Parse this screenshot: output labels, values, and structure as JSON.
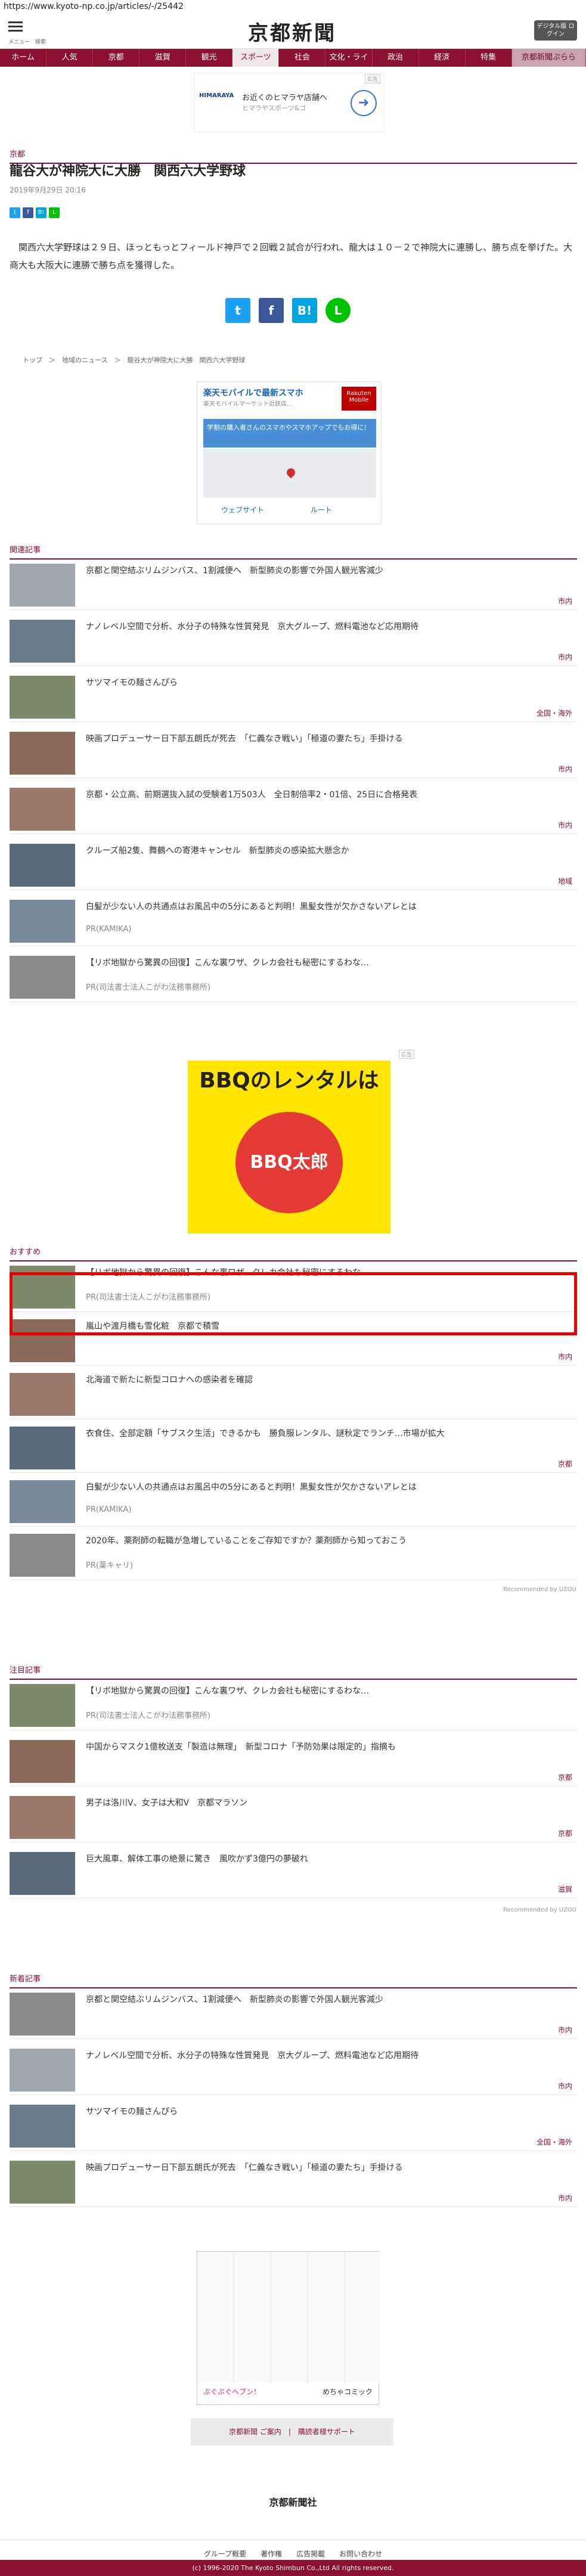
{
  "browser": {
    "url": "https://www.kyoto-np.co.jp/articles/-/25442"
  },
  "header": {
    "menu_label": "メニュー　検索",
    "logo": "京都新聞",
    "digital_label": "デジタル版 ログイン"
  },
  "nav": [
    "ホーム",
    "人気",
    "京都",
    "滋賀",
    "観光",
    "スポーツ",
    "社会",
    "文化・ライフ",
    "政治",
    "経済",
    "特集",
    "京都新聞ぷらら"
  ],
  "ad_top": {
    "label": "広告",
    "brand": "HIMARAYA",
    "line1": "お近くのヒマラヤ店舗へ",
    "line2": "ヒマラヤスポーツ&ゴ"
  },
  "article": {
    "section": "京都",
    "title": "龍谷大が神院大に大勝　関西六大学野球",
    "date": "2019年9月29日 20:16",
    "body": "関西六大学野球は２９日、ほっともっとフィールド神戸で２回戦２試合が行われ、龍大は１０－２で神院大に連勝し、勝ち点を挙げた。大商大も大阪大に連勝で勝ち点を獲得した。",
    "share_small": [
      "t",
      "f",
      "B!",
      "L"
    ],
    "share_big": [
      "t",
      "f",
      "B!",
      "L"
    ]
  },
  "breadcrumb": "トップ　＞　地域のニュース　＞　龍谷大が神院大に大勝　関西六大学野球",
  "map_ad": {
    "headline": "楽天モバイルで最新スマホ",
    "sub": "楽天モバイルマーケット近鉄店…",
    "rakuten": "Rakuten Mobile",
    "banner": "学割の購入者さんのスマホやスマホアップでもお得に!",
    "btn_web": "ウェブサイト",
    "btn_route": "ルート"
  },
  "related": {
    "heading": "関連記事",
    "items": [
      {
        "text": "京都と関空結ぶリムジンバス、1割減便へ　新型肺炎の影響で外国人観光客減少",
        "tag": "市内"
      },
      {
        "text": "ナノレベル空間で分析、水分子の特殊な性質発見　京大グループ、燃料電池など応用期待",
        "tag": "市内"
      },
      {
        "text": "サツマイモの麺さんぴら",
        "tag": "全国・海外"
      },
      {
        "text": "映画プロデューサー日下部五朗氏が死去　「仁義なき戦い」「極道の妻たち」手掛ける",
        "tag": "市内"
      },
      {
        "text": "京都・公立高、前期選抜入試の受験者1万503人　全日制倍率2・01倍、25日に合格発表",
        "tag": "市内"
      },
      {
        "text": "クルーズ船2隻、舞鶴への寄港キャンセル　新型肺炎の感染拡大懸念か",
        "tag": "地域"
      },
      {
        "text": "白髪が少ない人の共通点はお風呂中の5分にあると判明！黒髪女性が欠かさないアレとは",
        "pr": "PR(KAMIKA)"
      },
      {
        "text": "【リボ地獄から驚異の回復】こんな裏ワザ、クレカ会社も秘密にするわな…",
        "pr": "PR(司法書士法人こがわ法務事務所)"
      }
    ]
  },
  "bbq_ad": {
    "label": "広告",
    "headline": "BBQのレンタルは",
    "brand": "BBQ太郎"
  },
  "recommend": {
    "heading": "おすすめ",
    "items": [
      {
        "text": "【リボ地獄から驚異の回復】こんな裏ワザ、クレカ会社も秘密にするわな…",
        "pr": "PR(司法書士法人こがわ法務事務所)"
      },
      {
        "text": "嵐山や渡月橋も雪化粧　京都で積雪",
        "tag": "市内"
      },
      {
        "text": "北海道で新たに新型コロナへの感染者を確認",
        "tag": ""
      },
      {
        "text": "衣食住、全部定額「サブスク生活」できるかも　勝負服レンタル、謎秋定でランチ…市場が拡大",
        "tag": "京都"
      },
      {
        "text": "白髪が少ない人の共通点はお風呂中の5分にあると判明！黒髪女性が欠かさないアレとは",
        "pr": "PR(KAMIKA)"
      },
      {
        "text": "2020年、薬剤師の転職が急増していることをご存知ですか？薬剤師から知っておこう",
        "pr": "PR(薬キャリ)"
      }
    ],
    "credit": "Recommended by UZOU"
  },
  "attention": {
    "heading": "注目記事",
    "items": [
      {
        "text": "【リボ地獄から驚異の回復】こんな裏ワザ、クレカ会社も秘密にするわな…",
        "pr": "PR(司法書士法人こがわ法務事務所)"
      },
      {
        "text": "中国からマスク1億枚送支「製造は無理」　新型コロナ「予防効果は限定的」指摘も",
        "tag": "京都"
      },
      {
        "text": "男子は洛川V、女子は大和V　京都マラソン",
        "tag": "京都"
      },
      {
        "text": "巨大風車、解体工事の絶景に驚き　風吹かず3億円の夢破れ",
        "tag": "滋賀"
      }
    ],
    "credit": "Recommended by UZOU"
  },
  "latest": {
    "heading": "新着記事",
    "items": [
      {
        "text": "京都と関空結ぶリムジンバス、1割減便へ　新型肺炎の影響で外国人観光客減少",
        "tag": "市内"
      },
      {
        "text": "ナノレベル空間で分析、水分子の特殊な性質発見　京大グループ、燃料電池など応用期待",
        "tag": "市内"
      },
      {
        "text": "サツマイモの麺さんぴら",
        "tag": "全国・海外"
      },
      {
        "text": "映画プロデューサー日下部五朗氏が死去　「仁義なき戦い」「極道の妻たち」手掛ける",
        "tag": "市内"
      }
    ]
  },
  "manga_ad": {
    "label": "めちゃコミック",
    "caption": "ぶぐぶぐヘブン！"
  },
  "footer": {
    "buttons": "京都新聞 ご案内　|　購読者様サポート",
    "logo": "京都新聞社",
    "links": "グループ概要　　著作権　　広告掲載　　お問い合わせ",
    "copyright": "(c) 1996-2020 The Kyoto Shimbun Co.,Ltd All rights reserved."
  },
  "colors": {
    "brand": "#8b0f2f",
    "highlight": "#e00000"
  }
}
